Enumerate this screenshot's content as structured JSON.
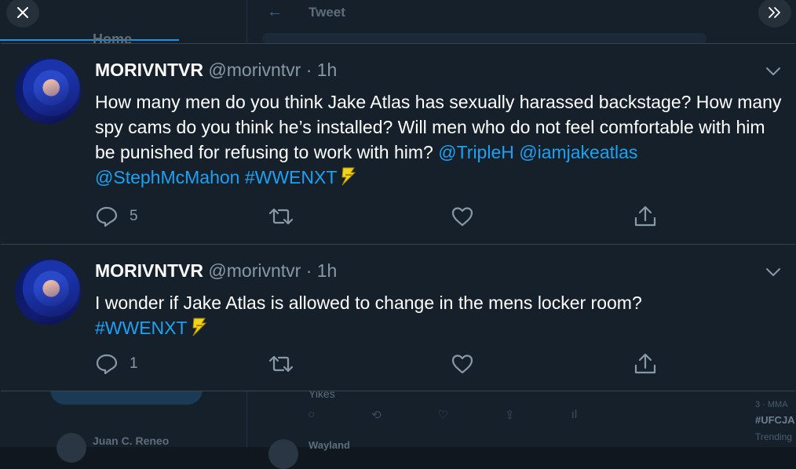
{
  "background": {
    "header_title": "Tweet",
    "nav_home": "Home",
    "reply_text": "Yikes",
    "left_user": "Juan C. Reneo",
    "bottom_user": "Wayland",
    "trend_meta": "3 · MMA",
    "trend_tag": "#UFCJA",
    "trend_label": "Trending"
  },
  "colors": {
    "link": "#1da1f2",
    "muted": "#8899a6",
    "panel": "#15202b"
  },
  "tweets": [
    {
      "name": "MORIVNTVR",
      "handle": "@morivntvr",
      "dot": "·",
      "time": "1h",
      "text": "How many men do you think Jake Atlas has sexually harassed backstage? How many spy cams do you think he’s installed? Will men who do not feel comfortable with him be punished for refusing to work with him?",
      "mentions": [
        "@TripleH",
        "@iamjakeatlas",
        "@StephMcMahon"
      ],
      "hashtag": "#WWENXT",
      "reply_count": "5"
    },
    {
      "name": "MORIVNTVR",
      "handle": "@morivntvr",
      "dot": "·",
      "time": "1h",
      "text": "I wonder if Jake Atlas is allowed to change in the mens locker room?",
      "hashtag": "#WWENXT",
      "reply_count": "1"
    }
  ]
}
